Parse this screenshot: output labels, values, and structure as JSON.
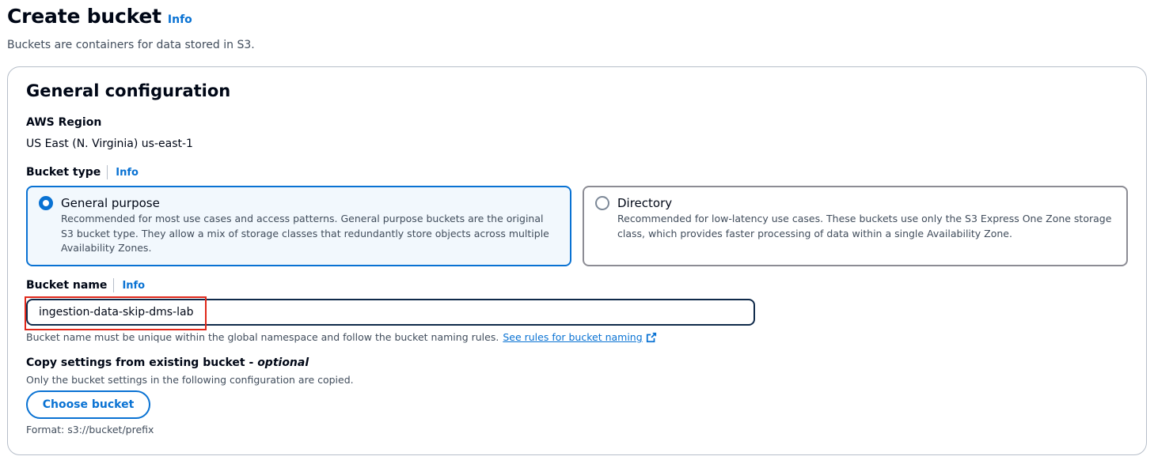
{
  "page": {
    "title": "Create bucket",
    "info_label": "Info",
    "description": "Buckets are containers for data stored in S3."
  },
  "general_configuration": {
    "title": "General configuration",
    "region": {
      "label": "AWS Region",
      "value": "US East (N. Virginia) us-east-1"
    },
    "bucket_type": {
      "label": "Bucket type",
      "info_label": "Info",
      "options": [
        {
          "title": "General purpose",
          "description": "Recommended for most use cases and access patterns. General purpose buckets are the original S3 bucket type. They allow a mix of storage classes that redundantly store objects across multiple Availability Zones.",
          "selected": true
        },
        {
          "title": "Directory",
          "description": "Recommended for low-latency use cases. These buckets use only the S3 Express One Zone storage class, which provides faster processing of data within a single Availability Zone.",
          "selected": false
        }
      ]
    },
    "bucket_name": {
      "label": "Bucket name",
      "info_label": "Info",
      "value": "ingestion-data-skip-dms-lab",
      "constraint_text": "Bucket name must be unique within the global namespace and follow the bucket naming rules.",
      "rules_link": "See rules for bucket naming"
    },
    "copy_settings": {
      "label": "Copy settings from existing bucket - ",
      "label_optional": "optional",
      "description": "Only the bucket settings in the following configuration are copied.",
      "button_label": "Choose bucket",
      "format_hint": "Format: s3://bucket/prefix"
    }
  },
  "colors": {
    "link": "#0972d3",
    "highlight": "#e0281a",
    "selected_tile_bg": "#f2f8fd"
  }
}
